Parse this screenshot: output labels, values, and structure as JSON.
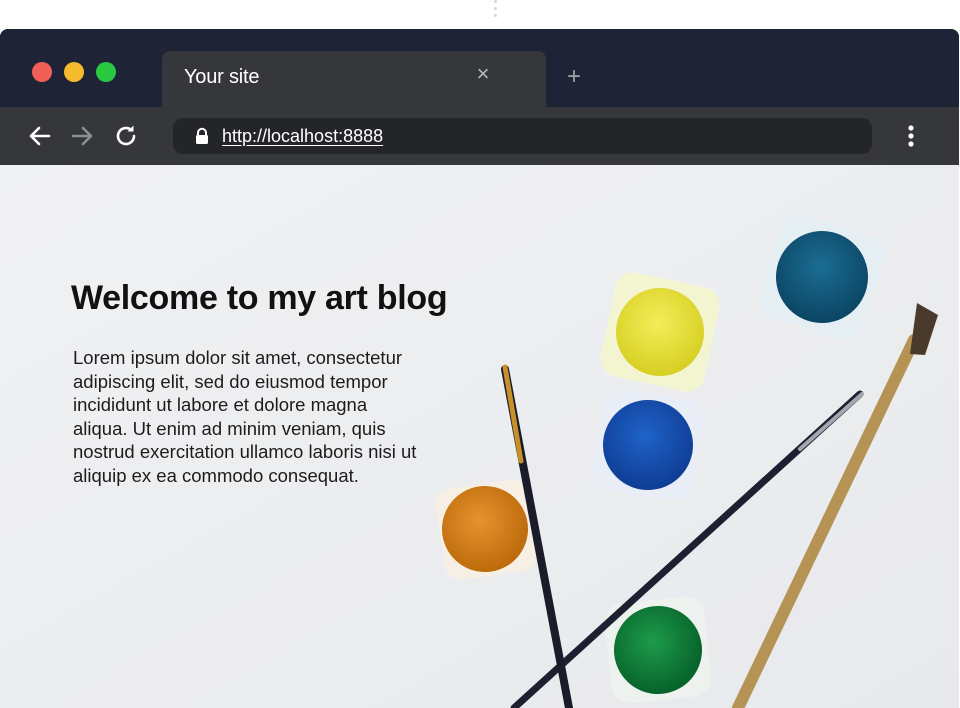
{
  "browser": {
    "tab": {
      "title": "Your site",
      "close_glyph": "×"
    },
    "new_tab_glyph": "+",
    "address_bar": {
      "url": "http://localhost:8888"
    },
    "icons": {
      "back": "arrow-left-icon",
      "forward": "arrow-right-icon",
      "reload": "reload-icon",
      "lock": "lock-icon",
      "menu": "kebab-menu-icon"
    },
    "colors": {
      "chrome": "#1e2335",
      "toolbar": "#35373b",
      "omnibox": "#242528",
      "close_red": "#f25f56",
      "minimize_yellow": "#f5bb2c",
      "zoom_green": "#28c840"
    }
  },
  "page": {
    "heading": "Welcome to my art blog",
    "body": "Lorem ipsum dolor sit amet, consectetur adipiscing elit, sed do eiusmod tempor incididunt ut labore et dolore magna aliqua. Ut enim ad minim veniam, quis nostrud exercitation ullamco laboris nisi ut aliquip ex ea commodo consequat.",
    "background": "watercolor paints and brushes photo"
  }
}
